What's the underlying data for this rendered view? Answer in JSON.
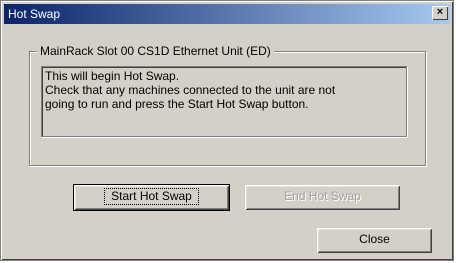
{
  "window": {
    "title": "Hot Swap",
    "close_glyph": "×"
  },
  "group": {
    "title": "MainRack Slot 00 CS1D Ethernet Unit (ED)"
  },
  "message": {
    "text": "This will begin Hot Swap.\nCheck that any machines connected to the unit are not\ngoing to run and press the Start Hot Swap button."
  },
  "buttons": {
    "start": {
      "label": "Start Hot Swap",
      "enabled": true
    },
    "end": {
      "label": "End Hot Swap",
      "enabled": false
    },
    "close": {
      "label": "Close",
      "enabled": true
    }
  },
  "colors": {
    "face": "#d4d0c8",
    "title_start": "#0a246a",
    "title_end": "#a6caf0",
    "disabled_text": "#a0a0a0"
  },
  "icons": {
    "close": "close-icon"
  }
}
